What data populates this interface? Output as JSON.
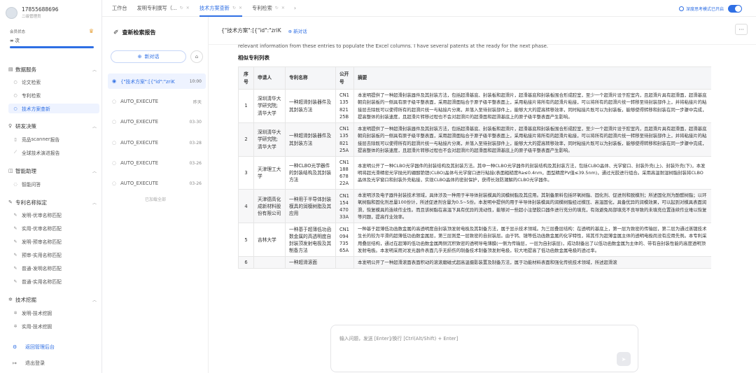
{
  "user": {
    "phone": "17855688696",
    "subtitle": "二级管理员"
  },
  "member": {
    "label": "会员状态",
    "value": "∞",
    "value_suffix": "次",
    "progress": 1.0
  },
  "sidebar": {
    "sections": [
      {
        "label": "数据服务",
        "icon": "database-icon",
        "items": [
          {
            "label": "论文检索",
            "icon": "search-icon"
          },
          {
            "label": "专利检索",
            "icon": "search-icon"
          },
          {
            "label": "技术方案查新",
            "icon": "search-icon",
            "active": true
          }
        ]
      },
      {
        "label": "研发决策",
        "icon": "bulb-icon",
        "items": [
          {
            "label": "竞品scanner报告",
            "icon": "document-icon"
          },
          {
            "label": "全球技术演进报告",
            "icon": "trend-icon"
          }
        ]
      },
      {
        "label": "智能助理",
        "icon": "robot-icon",
        "items": [
          {
            "label": "智能问答",
            "icon": "chat-icon"
          }
        ]
      },
      {
        "label": "专利名称拟定",
        "icon": "pen-icon",
        "items": [
          {
            "label": "发明-优审名称匹配",
            "icon": "pen-icon"
          },
          {
            "label": "实用-优审名称匹配",
            "icon": "pen-icon"
          },
          {
            "label": "发明-预审名称匹配",
            "icon": "pen-icon"
          },
          {
            "label": "预审-实用名称匹配",
            "icon": "pen-icon"
          },
          {
            "label": "普通-发明名称匹配",
            "icon": "pen-icon"
          },
          {
            "label": "普通-实用名称匹配",
            "icon": "pen-icon"
          }
        ]
      },
      {
        "label": "技术挖掘",
        "icon": "sparkle-icon",
        "items": [
          {
            "label": "发明-技术挖掘",
            "icon": "sparkle-icon"
          },
          {
            "label": "实用-技术挖掘",
            "icon": "sparkle-icon"
          }
        ]
      }
    ],
    "footer": {
      "admin_label": "返回管理后台",
      "logout_label": "退出登录"
    }
  },
  "tabs": [
    {
      "label": "工作台",
      "active": false,
      "closable": false
    },
    {
      "label": "发明专利撰写（...",
      "active": false,
      "closable": true
    },
    {
      "label": "技术方案查新",
      "active": true,
      "closable": true
    },
    {
      "label": "专利检索",
      "active": false,
      "closable": true
    }
  ],
  "deep_mode": {
    "label": "深度思考模式已开启",
    "enabled": true
  },
  "history": {
    "title": "查新检索报告",
    "new_chat_label": "新对话",
    "items": [
      {
        "title": "{\"技术方案\":[{\"id\":\"zriK",
        "date": "10:00",
        "active": true
      },
      {
        "title": "AUTO_EXECUTE",
        "date": "昨天",
        "active": false
      },
      {
        "title": "AUTO_EXECUTE",
        "date": "03-30",
        "active": false
      },
      {
        "title": "AUTO_EXECUTE",
        "date": "03-28",
        "active": false
      },
      {
        "title": "AUTO_EXECUTE",
        "date": "03-26",
        "active": false
      },
      {
        "title": "AUTO_EXECUTE",
        "date": "03-26",
        "active": false
      }
    ],
    "loaded_all": "已加载全部"
  },
  "conversation": {
    "title": "{\"技术方案\":[{\"id\":\"zriK",
    "new_label": "新对话",
    "message": "relevant information from these entries to populate the Excel columns. I have several patents at the ready for the next phase.",
    "list_title": "相似专利列表"
  },
  "table": {
    "headers": [
      "序号",
      "申请人",
      "专利名称",
      "公开号",
      "摘要"
    ],
    "rows": [
      {
        "no": "1",
        "applicant": "深圳清华大学研究院;清华大学",
        "name": "一种超滑封装器件及其封装方法",
        "pub": "CN113582125B",
        "abstract": "本发明提供了一种超滑封装器件及其封装方法，包括超滑基底、封装板和超滑片，超滑基底和封装板围合形成腔室，至少一个超滑片设于腔室内，且超滑片具有超滑面，超滑基底朝向封装板的一侧具有原子级平整表面，采用超滑面贴合于原子级平整表面上，采用粘接片将所有的超滑片粘接，可以将所有的超滑片统一转移至待封装部件上，并将粘接片的粘接层去除既可以使得所有的超滑片统一与粘接片分离，并落入至待封装部件上，能够大大的提高转移效率，同时粘接片既可以为封装板，能够使得转移和封装在同一步骤中完成，提高整体的封装速度，且超滑片转移过程也不会对超滑片的超滑面和超滑基底上的原子级平整表面产生影响。"
      },
      {
        "no": "2",
        "applicant": "深圳清华大学研究院;清华大学",
        "name": "一种超滑封装器件及其封装方法",
        "pub": "CN113582125A",
        "abstract": "本发明提供了一种超滑封装器件及其封装方法，包括超滑基底、封装板和超滑片，超滑基底和封装板围合形成腔室，至少一个超滑片设于腔室内，且超滑片具有超滑面，超滑基底朝向封装板的一侧具有原子级平整表面，采用超滑面贴合于原子级平整表面上，采用粘接片将所有的超滑片粘接，可以将所有的超滑片统一转移至待封装部件上，并将粘接片的粘接层去除既可以使得所有的超滑片统一与粘接片分离，并落入至待封装部件上，能够大大的提高转移效率，同时粘接片既可以为封装板，能够使得转移和封装在同一步骤中完成，提高整体的封装速度，且超滑片转移过程也不会对超滑片的超滑面和超滑基底上的原子级平整表面产生影响。"
      },
      {
        "no": "3",
        "applicant": "天津理工大学",
        "name": "一种CLBO光学器件的封装结构及其封装方法",
        "pub": "CN118867822A",
        "abstract": "本发明公开了一种CLBO光学器件的封装结构及其封装方法。其中一种CLBO光学器件的封装结构及其封装方法，包括CLBO晶体、光学窗口、封装外壳(上)、封装外壳(下)，本发明将超光滑精密光学抛光的硼酸铯锂(CLBO)晶体与光学窗口进行粘接(表面粗糙度Ra≤0.4nm，面型精度PV值≤39.5nm)，通过光胶进行组合。采用高温耐湿树脂封装将CLBO晶体及光学窗口和封装外壳粘接，实现CLBO晶体的密封保护，获得长效防潮解的CLBO光学器件。"
      },
      {
        "no": "4",
        "applicant": "天津德高化成新材料股份有限公司",
        "name": "一种用于半导体封装模具的润模树脂及其应用",
        "pub": "CN115447033A",
        "abstract": "本发明涉及电子器件封装技术领域，具体涉及一种用于半导体封装模具的润模树脂及其应用。其制备原料包括环氧树脂、固化剂、促进剂和脱模剂；所述固化剂为酚醛树脂；以环氧树脂和固化剂总量100份计，所述促进剂含量为0.5~5份。本发明中提供的用于半导体封装模具的润模树脂经过模压、高温固化，具备优异的润模效果，可以起到对模具表面润滑，恢复模具的连续作业性。而且该树脂在高温下具有优异的流动性，能够对一些超小注塑胶口器件进行充分的填充，有效避免局部填充不良导致的未填充位置连续作业难以恢复等问题，提高作业效率。"
      },
      {
        "no": "5",
        "applicant": "吉林大学",
        "name": "一种基于超薄低功函数金属的高透明度自封装顶发射电极及其制备方法",
        "pub": "CN109473565A",
        "abstract": "一种基于超薄低功函数金属的高透明度自封装顶发射电极及其制备方法，属于显示技术领域。为三层叠层结构：在透明的基底上，第一层为致密的传输层，第二层为通过蒸镀技术生长的较为平滑的超薄低功函数金属层，第三层则是一层致密的自封装层。由于钙、镱等低功函数金属的化学特性，将其作为超薄金属主体的透明电极尚没有应用先例。本专利采用叠层结构，通过在超薄的低功函数金属两侧沉积致密的透明导电薄膜(一侧为传输层，一层为自封装层)，成功制备出了以低功函数金属为主体的、带有自封装性能的高度透明顶发射电极。本发明采用对发光器件表面几乎无损伤的制备技术制备顶发射电极，较大地提高了低功函数金属电极的透过率。"
      },
      {
        "no": "6",
        "applicant": "",
        "name": "一种超滑滚面",
        "pub": "",
        "abstract": "本发明公开了一种超滑滚面表面积动的滚滚磨磁式超高温摄影装置及制备方法，属于功能材料表面和强化传统技术领域，所述超滑滚"
      }
    ]
  },
  "composer": {
    "placeholder": "输入问题，发送 [Enter]/换行 [Ctrl(Alt/Shift) + Enter]"
  },
  "colors": {
    "accent": "#2f6fe4",
    "active_bg": "#eef3ff"
  }
}
